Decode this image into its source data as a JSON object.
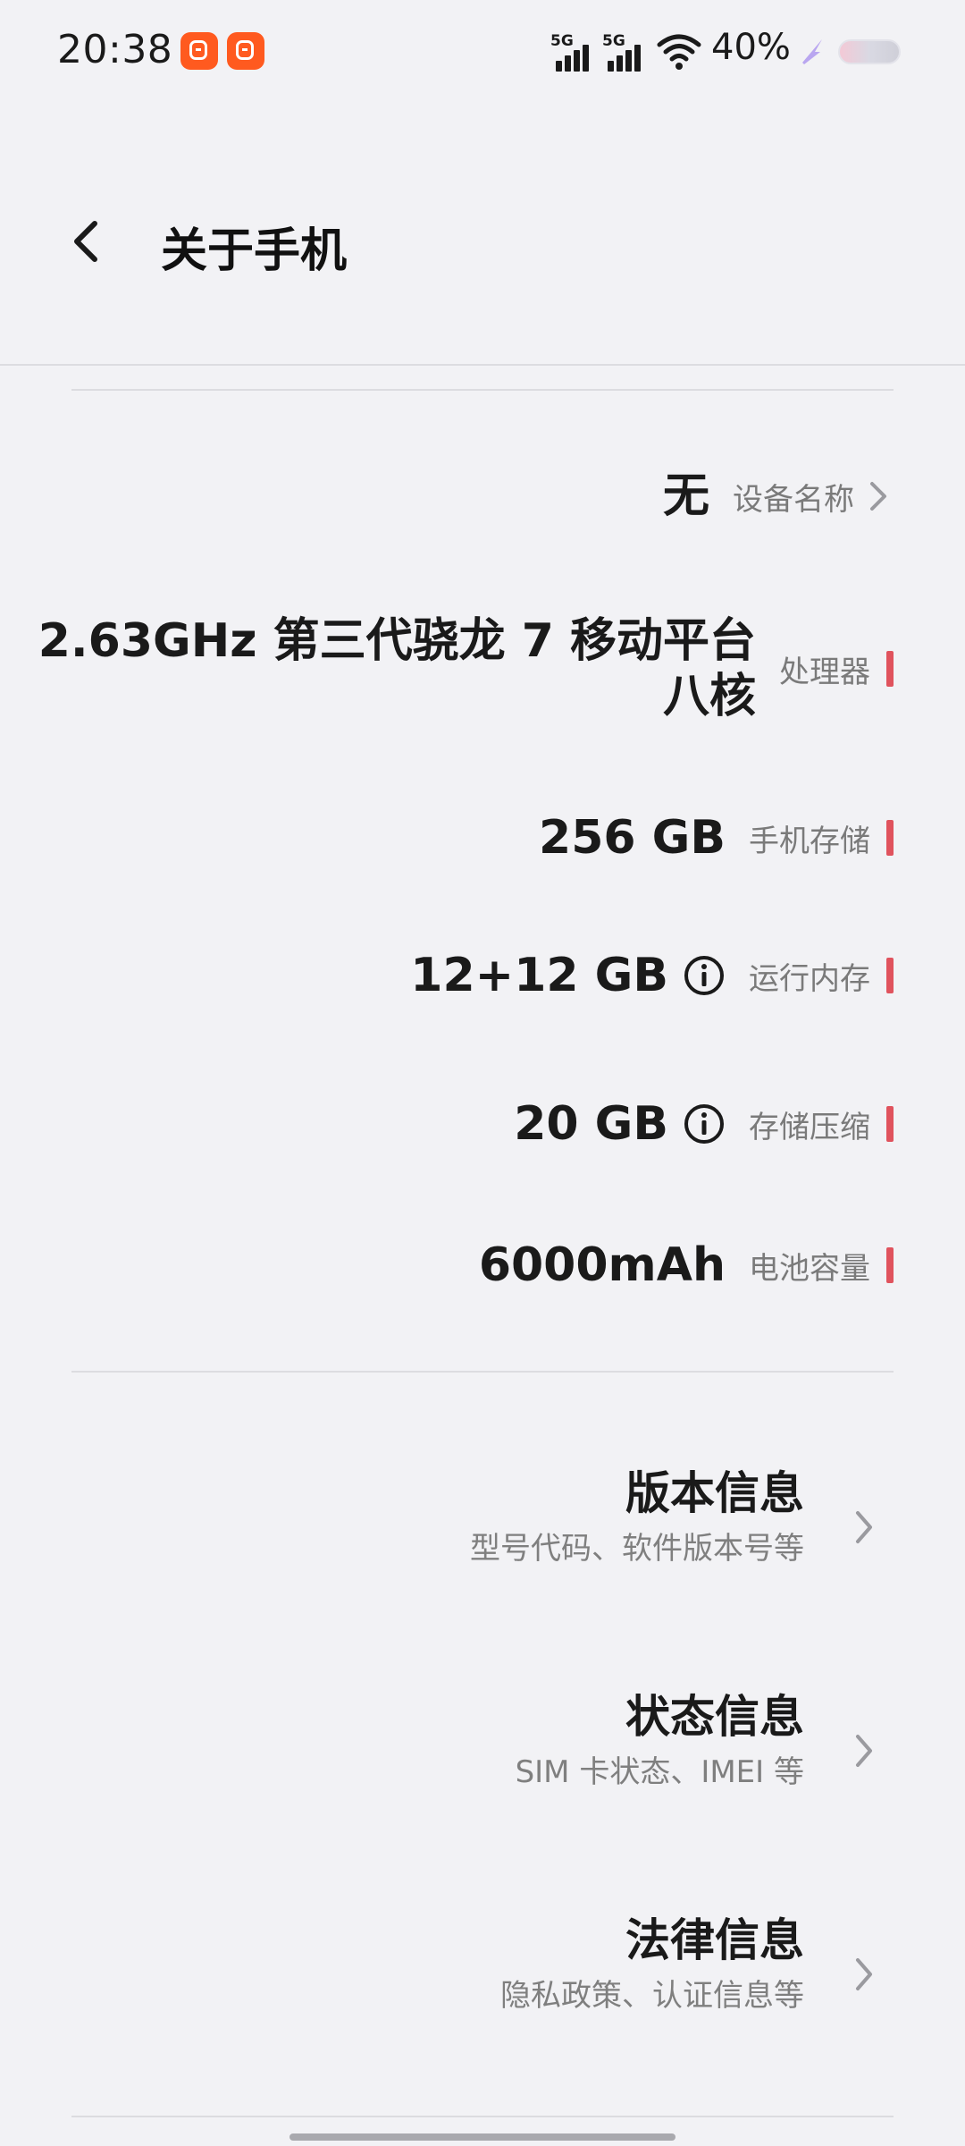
{
  "status_bar": {
    "time": "20:38",
    "signal_1_label": "5G",
    "signal_2_label": "5G",
    "battery_percent": "40%"
  },
  "header": {
    "title": "关于手机"
  },
  "specs": {
    "device_name": {
      "value": "无",
      "label": "设备名称"
    },
    "processor": {
      "value_line1": "2.63GHz 第三代骁龙 7 移动平台",
      "value_line2": "八核",
      "label": "处理器"
    },
    "storage": {
      "value": "256 GB",
      "label": "手机存储"
    },
    "ram": {
      "value": "12+12 GB",
      "label": "运行内存"
    },
    "storage_compression": {
      "value": "20 GB",
      "label": "存储压缩"
    },
    "battery_capacity": {
      "value": "6000mAh",
      "label": "电池容量"
    }
  },
  "menu": {
    "items": [
      {
        "title": "版本信息",
        "subtitle": "型号代码、软件版本号等"
      },
      {
        "title": "状态信息",
        "subtitle": "SIM 卡状态、IMEI 等"
      },
      {
        "title": "法律信息",
        "subtitle": "隐私政策、认证信息等"
      }
    ]
  },
  "colors": {
    "background": "#f2f2f5",
    "accent_mark": "#e0535d",
    "notif_icon": "#ff5a1f"
  },
  "icons": {
    "back": "back-arrow-icon",
    "chevron": "chevron-right-icon",
    "info": "info-circle-icon",
    "wifi": "wifi-icon",
    "notification": "app-notification-icon"
  }
}
